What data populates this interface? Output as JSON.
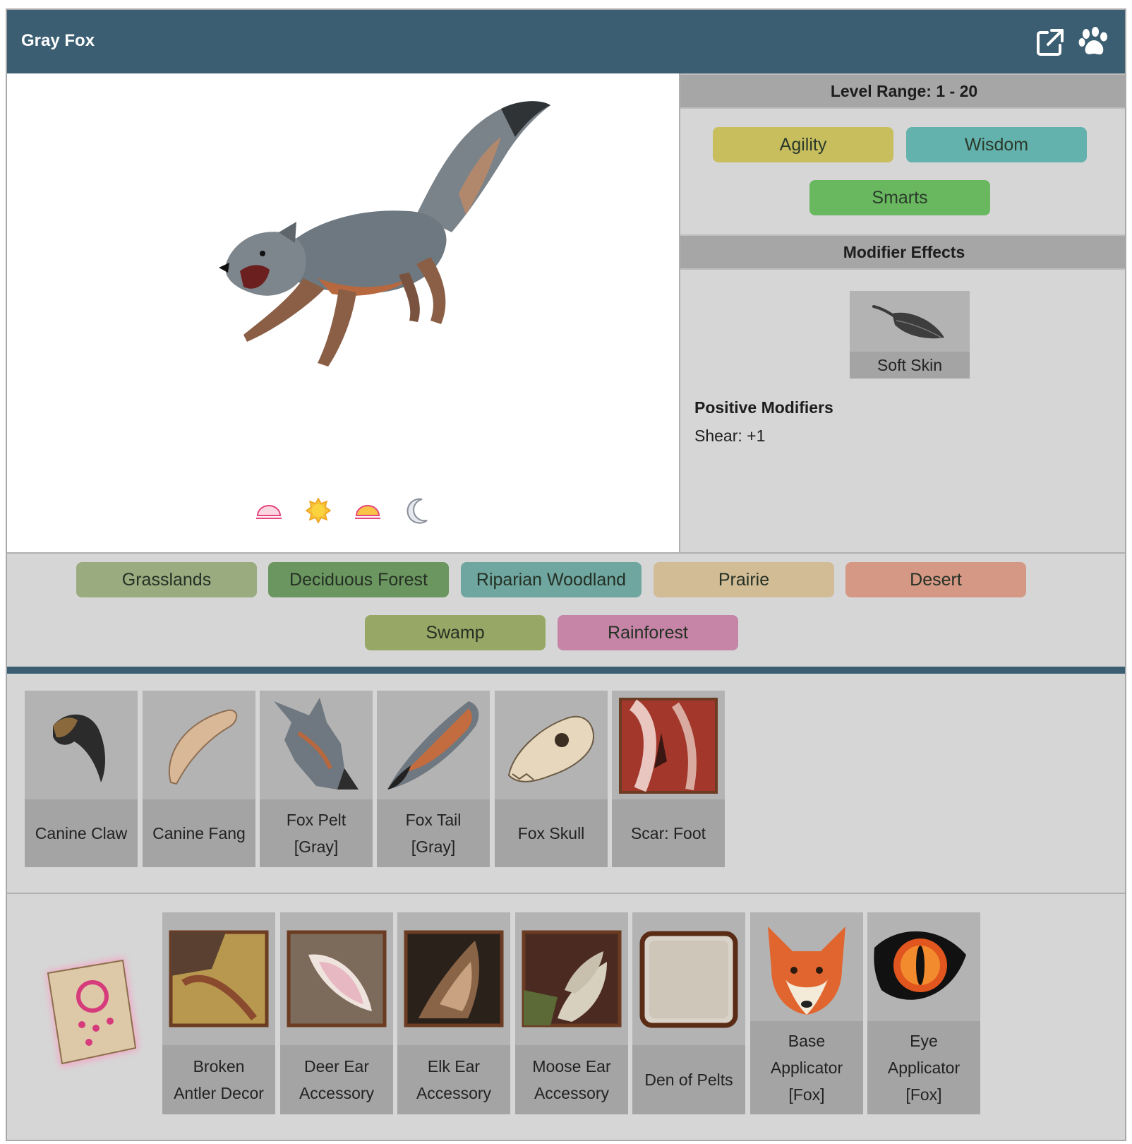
{
  "header": {
    "title": "Gray Fox",
    "icons": [
      "external-link-icon",
      "paw-icon"
    ]
  },
  "art": {
    "time_of_day": [
      "dawn-icon",
      "day-icon",
      "dusk-icon",
      "night-icon"
    ]
  },
  "stats": {
    "level_range": "Level Range: 1 - 20",
    "traits": [
      {
        "label": "Agility",
        "color": "#c8be5e"
      },
      {
        "label": "Wisdom",
        "color": "#63b2ad"
      },
      {
        "label": "Smarts",
        "color": "#69b860"
      }
    ],
    "modifier_header": "Modifier Effects",
    "modifier": {
      "label": "Soft Skin",
      "icon": "feather-icon"
    },
    "positive_title": "Positive Modifiers",
    "positive_line": "Shear: +1"
  },
  "habitats": [
    {
      "label": "Grasslands",
      "color": "#9aab80"
    },
    {
      "label": "Deciduous Forest",
      "color": "#6c9660"
    },
    {
      "label": "Riparian Woodland",
      "color": "#6fa6a0"
    },
    {
      "label": "Prairie",
      "color": "#d2bc96"
    },
    {
      "label": "Desert",
      "color": "#d59885"
    },
    {
      "label": "Swamp",
      "color": "#97a866"
    },
    {
      "label": "Rainforest",
      "color": "#c685a7"
    }
  ],
  "drops": [
    {
      "label": "Canine Claw",
      "icon": "claw-icon"
    },
    {
      "label": "Canine Fang",
      "icon": "fang-icon"
    },
    {
      "label": "Fox Pelt",
      "label2": "[Gray]",
      "icon": "pelt-icon"
    },
    {
      "label": "Fox Tail",
      "label2": "[Gray]",
      "icon": "tail-icon"
    },
    {
      "label": "Fox Skull",
      "icon": "skull-icon"
    },
    {
      "label": "Scar: Foot",
      "icon": "scar-icon"
    }
  ],
  "rewards": {
    "scroll_icon": "scroll-icon",
    "items": [
      {
        "lines": [
          "Broken",
          "Antler Decor"
        ],
        "icon": "antler-decor-icon"
      },
      {
        "lines": [
          "Deer Ear",
          "Accessory"
        ],
        "icon": "deer-ear-icon"
      },
      {
        "lines": [
          "Elk Ear",
          "Accessory"
        ],
        "icon": "elk-ear-icon"
      },
      {
        "lines": [
          "Moose Ear",
          "Accessory"
        ],
        "icon": "moose-ear-icon"
      },
      {
        "lines": [
          "Den of Pelts"
        ],
        "icon": "den-of-pelts-icon"
      },
      {
        "lines": [
          "Base",
          "Applicator",
          "[Fox]"
        ],
        "icon": "fox-face-icon"
      },
      {
        "lines": [
          "Eye",
          "Applicator",
          "[Fox]"
        ],
        "icon": "fox-eye-icon"
      }
    ]
  }
}
